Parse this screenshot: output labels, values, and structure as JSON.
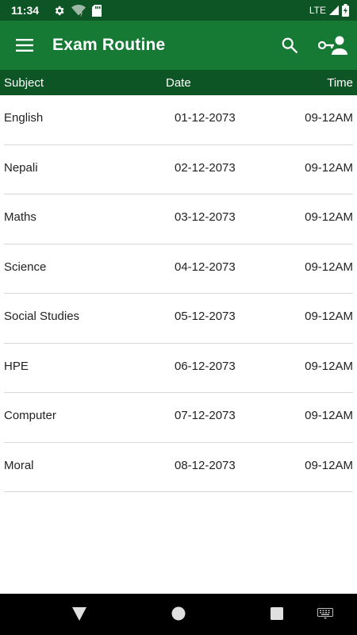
{
  "status_bar": {
    "time": "11:34",
    "network": "LTE",
    "icons": [
      "settings-icon",
      "wifi-question-icon",
      "sd-card-icon",
      "signal-icon",
      "battery-charging-icon"
    ]
  },
  "app_bar": {
    "title": "Exam Routine",
    "menu_icon": "hamburger-menu-icon",
    "actions": [
      "search-icon",
      "account-key-icon"
    ],
    "color": "#167a35"
  },
  "table": {
    "headers": {
      "subject": "Subject",
      "date": "Date",
      "time": "Time"
    },
    "rows": [
      {
        "subject": "English",
        "date": "01-12-2073",
        "time": "09-12AM"
      },
      {
        "subject": "Nepali",
        "date": "02-12-2073",
        "time": "09-12AM"
      },
      {
        "subject": "Maths",
        "date": "03-12-2073",
        "time": "09-12AM"
      },
      {
        "subject": "Science",
        "date": "04-12-2073",
        "time": "09-12AM"
      },
      {
        "subject": "Social Studies",
        "date": "05-12-2073",
        "time": "09-12AM"
      },
      {
        "subject": "HPE",
        "date": "06-12-2073",
        "time": "09-12AM"
      },
      {
        "subject": "Computer",
        "date": "07-12-2073",
        "time": "09-12AM"
      },
      {
        "subject": "Moral",
        "date": "08-12-2073",
        "time": "09-12AM"
      }
    ]
  },
  "nav_bar": {
    "buttons": [
      "back-icon",
      "home-icon",
      "recents-icon",
      "keyboard-icon"
    ]
  },
  "colors": {
    "status_bar": "#0d5524",
    "app_bar": "#167a35",
    "header": "#0d5524",
    "divider": "#d8d8d8"
  }
}
